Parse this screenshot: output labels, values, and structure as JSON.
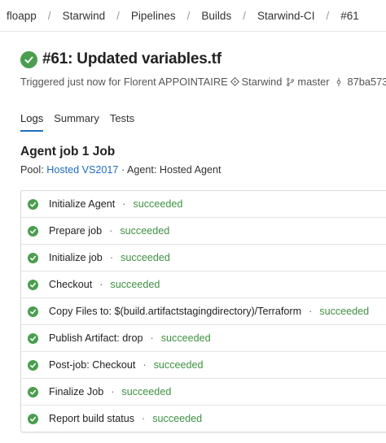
{
  "breadcrumb": {
    "items": [
      "floapp",
      "Starwind",
      "Pipelines",
      "Builds",
      "Starwind-CI",
      "#61"
    ],
    "separator": "/"
  },
  "header": {
    "title": "#61: Updated variables.tf",
    "status_icon": "check-circle-icon",
    "success_color": "#4a9e4e",
    "triggered_text": "Triggered just now for Florent APPOINTAIRE",
    "repo": "Starwind",
    "branch": "master",
    "commit": "87ba573"
  },
  "tabs": [
    {
      "label": "Logs",
      "active": true
    },
    {
      "label": "Summary",
      "active": false
    },
    {
      "label": "Tests",
      "active": false
    }
  ],
  "job": {
    "title": "Agent job 1 Job",
    "pool_label": "Pool:",
    "pool_link": "Hosted VS2017",
    "agent_text": "Agent: Hosted Agent",
    "separator": "·"
  },
  "steps": [
    {
      "name": "Initialize Agent",
      "status": "succeeded"
    },
    {
      "name": "Prepare job",
      "status": "succeeded"
    },
    {
      "name": "Initialize job",
      "status": "succeeded"
    },
    {
      "name": "Checkout",
      "status": "succeeded"
    },
    {
      "name": "Copy Files to: $(build.artifactstagingdirectory)/Terraform",
      "status": "succeeded"
    },
    {
      "name": "Publish Artifact: drop",
      "status": "succeeded"
    },
    {
      "name": "Post-job: Checkout",
      "status": "succeeded"
    },
    {
      "name": "Finalize Job",
      "status": "succeeded"
    },
    {
      "name": "Report build status",
      "status": "succeeded"
    }
  ],
  "colors": {
    "link": "#1e6dc0",
    "status_text": "#3f9142",
    "accent_tab": "#1e6dc0"
  }
}
